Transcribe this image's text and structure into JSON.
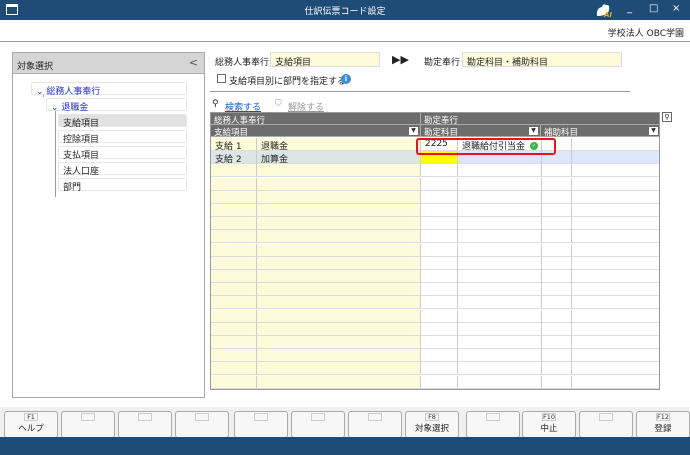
{
  "window": {
    "title": "仕訳伝票コード設定",
    "company": "学校法人 OBC学園",
    "minimize": "_",
    "maximize": "□",
    "close": "×"
  },
  "left_panel": {
    "title": "対象選択",
    "collapse": "<",
    "tree": [
      {
        "label": "総務人事奉行",
        "level": 0
      },
      {
        "label": "退職金",
        "level": 1
      },
      {
        "label": "支給項目",
        "level": 2,
        "selected": true
      },
      {
        "label": "控除項目",
        "level": 2
      },
      {
        "label": "支払項目",
        "level": 2
      },
      {
        "label": "法人口座",
        "level": 2
      },
      {
        "label": "部門",
        "level": 2
      }
    ]
  },
  "mapping": {
    "source_label": "総務人事奉行",
    "source_value": "支給項目",
    "arrow": "▶▶",
    "target_label": "勘定奉行",
    "target_value": "勘定科目・補助科目",
    "checkbox_label": "支給項目別に部門を指定する",
    "checkbox_checked": false
  },
  "toolbar": {
    "search": "検索する",
    "clear": "解除する"
  },
  "grid": {
    "group1": "総務人事奉行",
    "group2": "勘定奉行",
    "col1": "支給項目",
    "col2": "勘定科目",
    "col3": "補助科目",
    "rows": [
      {
        "code": "支給 1",
        "name": "退職金",
        "acct_code": "2225",
        "acct_name": "退職給付引当金",
        "valid": true
      },
      {
        "code": "支給 2",
        "name": "加算金",
        "acct_code": "",
        "acct_name": ""
      }
    ]
  },
  "fkeys": [
    {
      "key": "F1",
      "label": "ヘルプ"
    },
    {
      "key": "",
      "label": ""
    },
    {
      "key": "",
      "label": ""
    },
    {
      "key": "",
      "label": ""
    },
    {
      "key": "",
      "label": ""
    },
    {
      "key": "",
      "label": ""
    },
    {
      "key": "",
      "label": ""
    },
    {
      "key": "F8",
      "label": "対象選択"
    },
    {
      "key": "",
      "label": ""
    },
    {
      "key": "F10",
      "label": "中止"
    },
    {
      "key": "",
      "label": ""
    },
    {
      "key": "F12",
      "label": "登録"
    }
  ],
  "colors": {
    "titlebar": "#1f4c76",
    "highlight_border": "#e8141c",
    "input_yellow": "#fdfbd9",
    "active_cell": "#ffff00",
    "selected_row": "#dde6fb"
  }
}
